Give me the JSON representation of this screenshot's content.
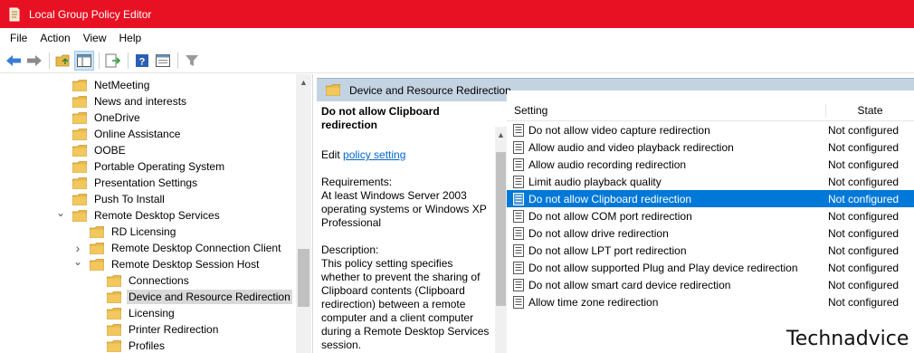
{
  "window": {
    "title": "Local Group Policy Editor"
  },
  "menu": [
    "File",
    "Action",
    "View",
    "Help"
  ],
  "toolbar": {
    "buttons": [
      "back-icon",
      "forward-icon",
      "up-folder-icon",
      "show-hide-tree-icon",
      "export-list-icon",
      "help-icon",
      "properties-view-icon",
      "filter-icon"
    ]
  },
  "tree": {
    "items": [
      {
        "label": "NetMeeting",
        "level": 0,
        "expander": "none"
      },
      {
        "label": "News and interests",
        "level": 0,
        "expander": "none"
      },
      {
        "label": "OneDrive",
        "level": 0,
        "expander": "none"
      },
      {
        "label": "Online Assistance",
        "level": 0,
        "expander": "none"
      },
      {
        "label": "OOBE",
        "level": 0,
        "expander": "none"
      },
      {
        "label": "Portable Operating System",
        "level": 0,
        "expander": "none"
      },
      {
        "label": "Presentation Settings",
        "level": 0,
        "expander": "none"
      },
      {
        "label": "Push To Install",
        "level": 0,
        "expander": "none"
      },
      {
        "label": "Remote Desktop Services",
        "level": 0,
        "expander": "expanded"
      },
      {
        "label": "RD Licensing",
        "level": 1,
        "expander": "none"
      },
      {
        "label": "Remote Desktop Connection Client",
        "level": 1,
        "expander": "collapsed"
      },
      {
        "label": "Remote Desktop Session Host",
        "level": 1,
        "expander": "expanded"
      },
      {
        "label": "Connections",
        "level": 2,
        "expander": "none"
      },
      {
        "label": "Device and Resource Redirection",
        "level": 2,
        "expander": "none",
        "selected": true
      },
      {
        "label": "Licensing",
        "level": 2,
        "expander": "none"
      },
      {
        "label": "Printer Redirection",
        "level": 2,
        "expander": "none"
      },
      {
        "label": "Profiles",
        "level": 2,
        "expander": "none"
      }
    ]
  },
  "header": {
    "title": "Device and Resource Redirection"
  },
  "description": {
    "title": "Do not allow Clipboard redirection",
    "edit_prefix": "Edit",
    "edit_link": "policy setting",
    "requirements_label": "Requirements:",
    "requirements": "At least Windows Server 2003 operating systems or Windows XP Professional",
    "description_label": "Description:",
    "description": "This policy setting specifies whether to prevent the sharing of Clipboard contents (Clipboard redirection) between a remote computer and a client computer during a Remote Desktop Services session."
  },
  "list": {
    "columns": {
      "setting": "Setting",
      "state": "State"
    },
    "rows": [
      {
        "setting": "Do not allow video capture redirection",
        "state": "Not configured"
      },
      {
        "setting": "Allow audio and video playback redirection",
        "state": "Not configured"
      },
      {
        "setting": "Allow audio recording redirection",
        "state": "Not configured"
      },
      {
        "setting": "Limit audio playback quality",
        "state": "Not configured"
      },
      {
        "setting": "Do not allow Clipboard redirection",
        "state": "Not configured",
        "selected": true
      },
      {
        "setting": "Do not allow COM port redirection",
        "state": "Not configured"
      },
      {
        "setting": "Do not allow drive redirection",
        "state": "Not configured"
      },
      {
        "setting": "Do not allow LPT port redirection",
        "state": "Not configured"
      },
      {
        "setting": "Do not allow supported Plug and Play device redirection",
        "state": "Not configured"
      },
      {
        "setting": "Do not allow smart card device redirection",
        "state": "Not configured"
      },
      {
        "setting": "Allow time zone redirection",
        "state": "Not configured"
      }
    ]
  },
  "watermark": "Technadvice",
  "colors": {
    "titlebar": "#e81123",
    "selection": "#0078d7",
    "header": "#c4d3e2",
    "folder": "#e8b84a"
  }
}
